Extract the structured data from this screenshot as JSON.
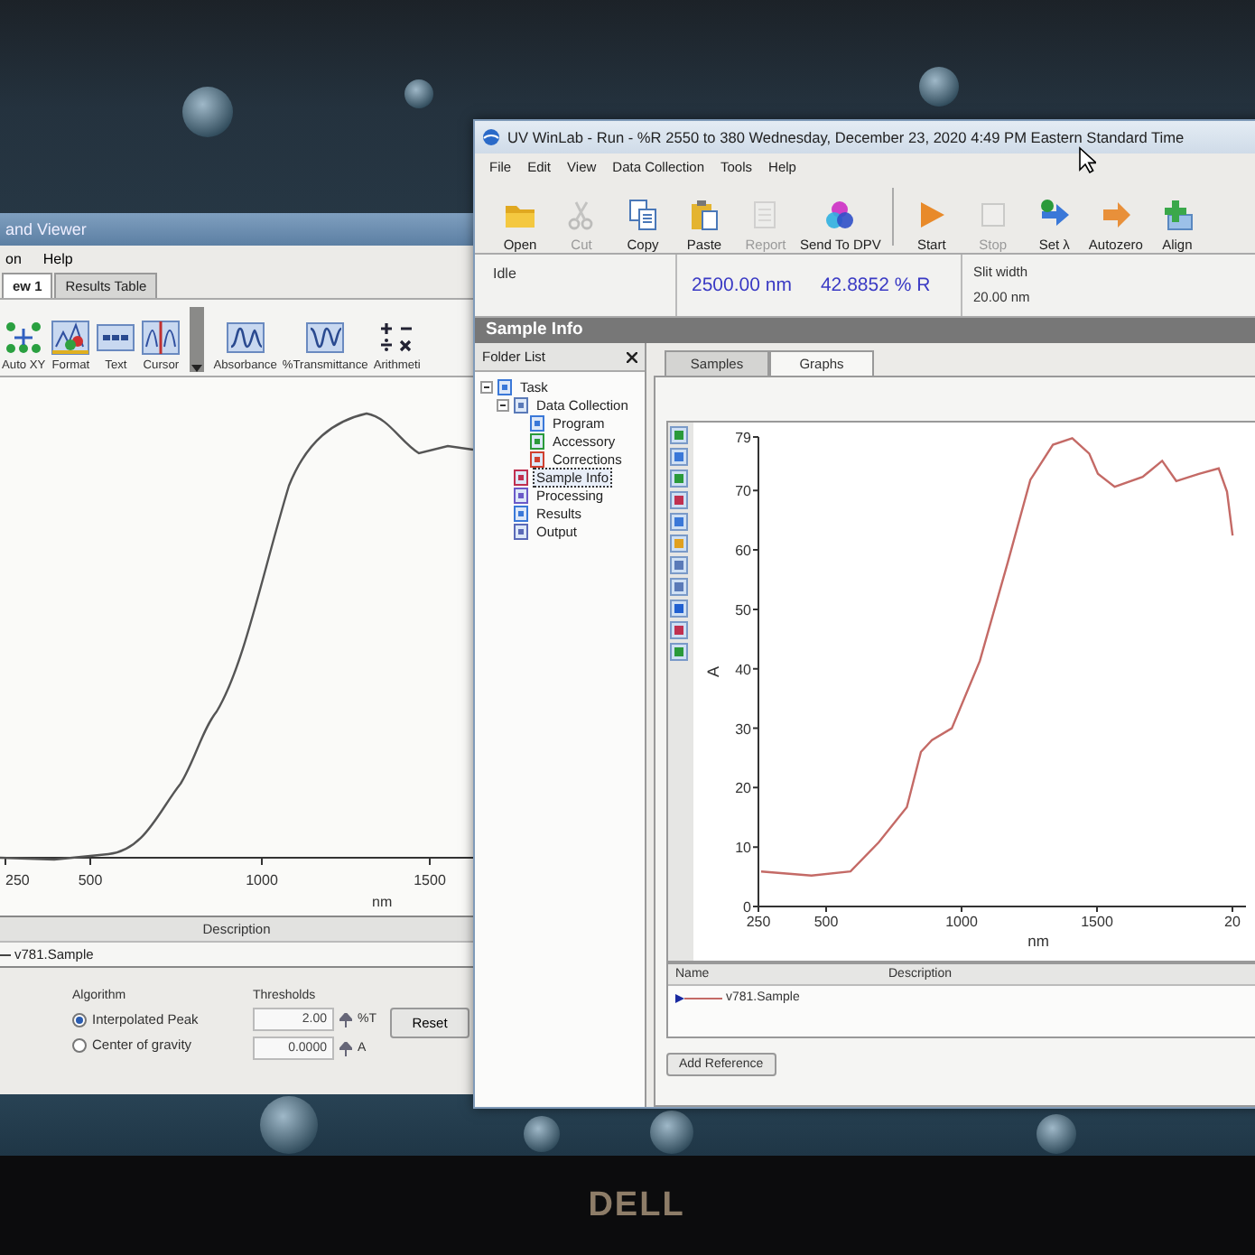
{
  "back_window": {
    "title": "and Viewer",
    "menu": [
      "on",
      "Help"
    ],
    "tabs": [
      {
        "label": "ew 1",
        "selected": true
      },
      {
        "label": "Results Table",
        "selected": false
      }
    ],
    "toolbar": [
      {
        "label": "Auto XY"
      },
      {
        "label": "Format"
      },
      {
        "label": "Text"
      },
      {
        "label": "Cursor"
      },
      {
        "label": "Absorbance"
      },
      {
        "label": "%Transmittance"
      },
      {
        "label": "Arithmeti"
      }
    ],
    "plot": {
      "x_tick_labels": [
        "250",
        "500",
        "1000",
        "1500"
      ],
      "xlabel": "nm"
    },
    "legend": {
      "columns": [
        "Description"
      ],
      "rows": [
        "v781.Sample"
      ]
    },
    "peak_settings": {
      "algorithm_label": "Algorithm",
      "algorithms": [
        {
          "label": "Interpolated Peak",
          "selected": true
        },
        {
          "label": "Center of gravity",
          "selected": false
        }
      ],
      "thresholds_label": "Thresholds",
      "thresholds": [
        {
          "value": "2.00",
          "unit": "%T"
        },
        {
          "value": "0.0000",
          "unit": "A"
        }
      ],
      "reset_button": "Reset"
    }
  },
  "front_window": {
    "title": "UV WinLab - Run - %R 2550 to 380 Wednesday, December 23, 2020 4:49 PM Eastern Standard Time",
    "menu": [
      "File",
      "Edit",
      "View",
      "Data Collection",
      "Tools",
      "Help"
    ],
    "toolbar": [
      {
        "label": "Open",
        "disabled": false
      },
      {
        "label": "Cut",
        "disabled": true
      },
      {
        "label": "Copy",
        "disabled": false
      },
      {
        "label": "Paste",
        "disabled": false
      },
      {
        "label": "Report",
        "disabled": true
      },
      {
        "label": "Send To DPV",
        "disabled": false
      },
      {
        "label": "Start",
        "disabled": false
      },
      {
        "label": "Stop",
        "disabled": true
      },
      {
        "label": "Set λ",
        "disabled": false
      },
      {
        "label": "Autozero",
        "disabled": false
      },
      {
        "label": "Align",
        "disabled": false
      }
    ],
    "status": {
      "state": "Idle",
      "wavelength": "2500.00 nm",
      "reading": "42.8852 % R",
      "slit_label": "Slit width",
      "slit_value": "20.00 nm"
    },
    "section_title": "Sample Info",
    "folder_list": {
      "title": "Folder List",
      "tree": [
        {
          "label": "Task",
          "expanded": true,
          "selected": false,
          "children": [
            {
              "label": "Data Collection",
              "expanded": true,
              "selected": false,
              "children": [
                {
                  "label": "Program",
                  "selected": false
                },
                {
                  "label": "Accessory",
                  "selected": false
                },
                {
                  "label": "Corrections",
                  "selected": false
                }
              ]
            },
            {
              "label": "Sample Info",
              "selected": true
            },
            {
              "label": "Processing",
              "selected": false
            },
            {
              "label": "Results",
              "selected": false
            },
            {
              "label": "Output",
              "selected": false
            }
          ]
        }
      ]
    },
    "tabs": [
      {
        "label": "Samples",
        "selected": false
      },
      {
        "label": "Graphs",
        "selected": true
      }
    ],
    "graph": {
      "chart_data": {
        "type": "line",
        "xlabel": "nm",
        "ylabel": "A",
        "x": [
          260,
          446,
          590,
          694,
          798,
          850,
          891,
          964,
          1067,
          1171,
          1254,
          1337,
          1409,
          1471,
          1503,
          1565,
          1669,
          1741,
          1793,
          1876,
          1949,
          1980,
          2001
        ],
        "series": [
          {
            "name": "v781.Sample",
            "color": "#c46a66",
            "values": [
              5.9,
              5.2,
              5.9,
              10.8,
              16.7,
              26,
              28,
              30,
              41.3,
              58,
              71.8,
              77.7,
              78.8,
              76.2,
              72.8,
              70.6,
              72.3,
              75,
              71.6,
              72.8,
              73.7,
              69.8,
              62.4
            ]
          }
        ],
        "xlim": [
          250,
          2050
        ],
        "ylim": [
          0,
          79
        ],
        "xticks": [
          250,
          500,
          1000,
          1500
        ],
        "yticks": [
          0,
          10,
          20,
          30,
          40,
          50,
          60,
          70,
          79
        ]
      },
      "cut_tick_label": "20"
    },
    "legend": {
      "columns": [
        "Name",
        "Description"
      ]
    },
    "add_reference_button": "Add Reference"
  },
  "monitor": {
    "logo": "DELL"
  }
}
